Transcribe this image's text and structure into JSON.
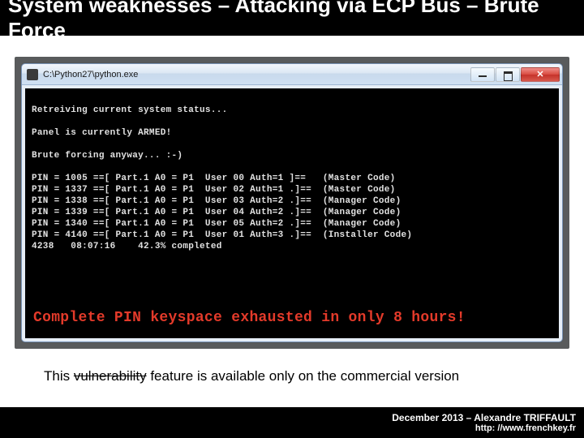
{
  "title": "System weaknesses – Attacking via ECP Bus – Brute Force",
  "window": {
    "title": "C:\\Python27\\python.exe"
  },
  "terminal": {
    "line_status": "Retreiving current system status...",
    "line_armed": "Panel is currently ARMED!",
    "line_brute": "Brute forcing anyway... :-)",
    "rows": [
      "PIN = 1005 ==[ Part.1 A0 = P1  User 00 Auth=1 ]==   (Master Code)",
      "PIN = 1337 ==[ Part.1 A0 = P1  User 02 Auth=1 .]==  (Master Code)",
      "PIN = 1338 ==[ Part.1 A0 = P1  User 03 Auth=2 .]==  (Manager Code)",
      "PIN = 1339 ==[ Part.1 A0 = P1  User 04 Auth=2 .]==  (Manager Code)",
      "PIN = 1340 ==[ Part.1 A0 = P1  User 05 Auth=2 .]==  (Manager Code)",
      "PIN = 4140 ==[ Part.1 A0 = P1  User 01 Auth=3 .]==  (Installer Code)"
    ],
    "progress": "4238   08:07:16    42.3% completed",
    "callout": "Complete PIN keyspace exhausted in only 8 hours!"
  },
  "caption": {
    "prefix": "This ",
    "struck": "vulnerability",
    "rest": " feature is available only on the commercial version"
  },
  "footer": {
    "line1": "December 2013 – Alexandre TRIFFAULT",
    "line2": "http: //www.frenchkey.fr"
  }
}
